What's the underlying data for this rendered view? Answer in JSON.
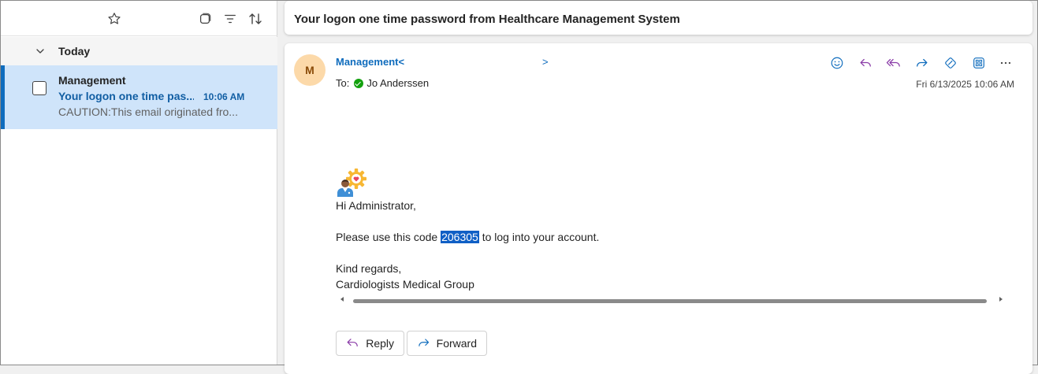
{
  "list": {
    "group_label": "Today",
    "message": {
      "sender": "Management",
      "subject": "Your logon one time pas...",
      "time": "10:06 AM",
      "preview": "CAUTION:This email originated fro..."
    }
  },
  "reading": {
    "subject": "Your logon one time password from Healthcare Management System",
    "avatar_initial": "M",
    "from_name": "Management<",
    "from_tail": ">",
    "to_label": "To:",
    "to_name": "Jo Anderssen",
    "date": "Fri 6/13/2025 10:06 AM",
    "body": {
      "greeting": "Hi Administrator,",
      "line_prefix": "Please use this code ",
      "code": "206305",
      "line_suffix": " to log into your account.",
      "closing": "Kind regards,",
      "signature": "Cardiologists Medical Group"
    },
    "reply_label": "Reply",
    "forward_label": "Forward"
  },
  "colors": {
    "accent": "#0f6cbd",
    "selected_row": "#cfe4fa",
    "reply_arrow": "#8b3da8",
    "highlight": "#0f5fc5"
  },
  "icons": [
    "star-icon",
    "select-icon",
    "filter-icon",
    "sort-icon",
    "chevron-down-icon",
    "emoji-icon",
    "reply-icon",
    "reply-all-icon",
    "forward-icon",
    "sticker-icon",
    "apps-icon",
    "more-icon",
    "doctor-gear-icon"
  ]
}
